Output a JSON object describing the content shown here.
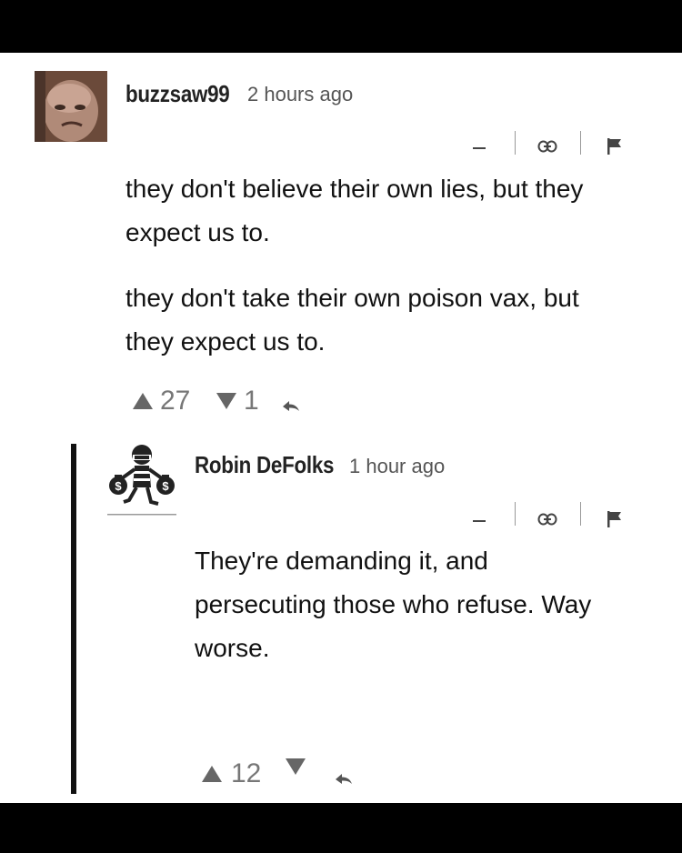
{
  "comments": [
    {
      "author": "buzzsaw99",
      "time": "2 hours ago",
      "paragraphs": [
        "they don't believe their own lies, but they expect us to.",
        "they don't take their own poison vax, but they expect us to."
      ],
      "upvotes": "27",
      "downvotes": "1",
      "tools": {
        "collapse_label": "–"
      },
      "icons": {
        "avatar": "avatar-photo",
        "link": "link-icon",
        "flag": "flag-icon",
        "reply": "reply-icon"
      }
    },
    {
      "author": "Robin DeFolks",
      "time": "1 hour ago",
      "paragraphs": [
        "They're demanding it, and persecuting those who refuse. Way worse."
      ],
      "upvotes": "12",
      "downvotes": "",
      "tools": {
        "collapse_label": "–"
      },
      "icons": {
        "avatar": "robber-with-money-bags",
        "link": "link-icon",
        "flag": "flag-icon",
        "reply": "reply-icon"
      }
    }
  ],
  "colors": {
    "page_bg": "#000000",
    "card_bg": "#ffffff",
    "text": "#111111",
    "muted": "#777777",
    "thread_bar": "#111111"
  }
}
